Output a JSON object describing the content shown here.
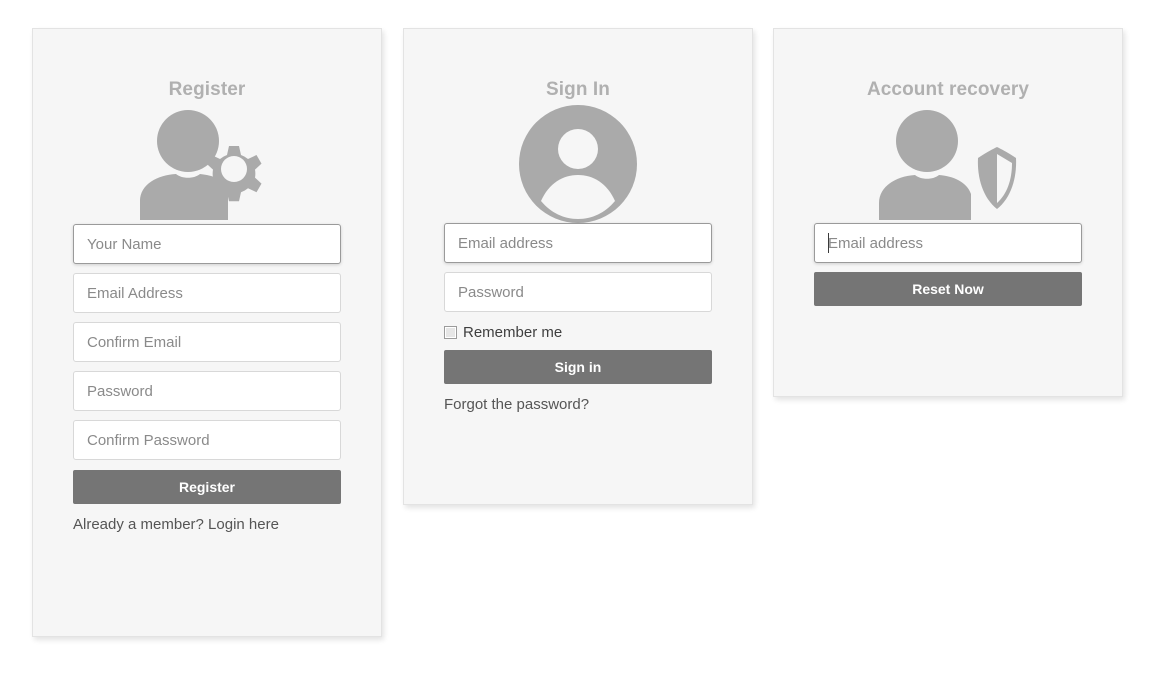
{
  "theme": {
    "page_background": "#ffffff",
    "card_background": "#f6f6f6",
    "card_border": "#e3e3e3",
    "heading_color": "#b0b0b0",
    "button_background": "#757575",
    "button_text": "#ffffff",
    "icon_color": "#aaaaaa",
    "placeholder_color": "#8a8a8a",
    "input_border": "#d8d8d8",
    "input_border_focused": "#9a9a9a"
  },
  "cards": {
    "register": {
      "title": "Register",
      "icon": "user-gear-icon",
      "fields": [
        {
          "name": "your-name",
          "placeholder": "Your Name",
          "value": "",
          "focused": true
        },
        {
          "name": "email-address",
          "placeholder": "Email Address",
          "value": "",
          "focused": false
        },
        {
          "name": "confirm-email",
          "placeholder": "Confirm Email",
          "value": "",
          "focused": false
        },
        {
          "name": "password",
          "placeholder": "Password",
          "value": "",
          "focused": false
        },
        {
          "name": "confirm-password",
          "placeholder": "Confirm Password",
          "value": "",
          "focused": false
        }
      ],
      "submit_label": "Register",
      "helper_text": "Already a member? Login here"
    },
    "signin": {
      "title": "Sign In",
      "icon": "user-avatar-icon",
      "fields": [
        {
          "name": "email-address",
          "placeholder": "Email address",
          "value": "",
          "focused": true
        },
        {
          "name": "password",
          "placeholder": "Password",
          "value": "",
          "focused": false
        }
      ],
      "remember_me": {
        "label": "Remember me",
        "checked": false
      },
      "submit_label": "Sign in",
      "helper_text": "Forgot the password?"
    },
    "recovery": {
      "title": "Account recovery",
      "icon": "user-shield-icon",
      "fields": [
        {
          "name": "email-address",
          "placeholder": "Email address",
          "value": "",
          "focused": true,
          "caret": true
        }
      ],
      "submit_label": "Reset Now"
    }
  }
}
